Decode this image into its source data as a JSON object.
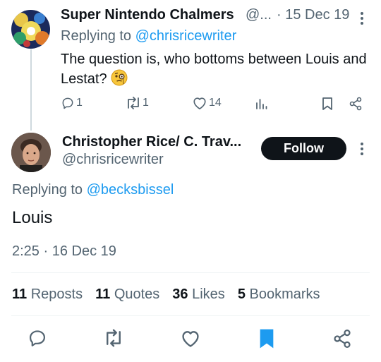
{
  "reply_tweet": {
    "author_name": "Super Nintendo Chalmers",
    "handle_truncated": "@...",
    "date": "· 15 Dec 19",
    "replying_to_label": "Replying to",
    "replying_to_handle": "@chrisricewriter",
    "text": "The question is, who bottoms between Louis and Lestat?",
    "emoji": "face-with-monocle",
    "actions": {
      "replies": "1",
      "reposts": "1",
      "likes": "14"
    }
  },
  "main_tweet": {
    "author_name": "Christopher Rice/ C. Trav...",
    "handle": "@chrisricewriter",
    "follow_label": "Follow",
    "replying_to_label": "Replying to",
    "replying_to_handle": "@becksbissel",
    "text": "Louis",
    "timestamp": "2:25 · 16 Dec 19",
    "stats": {
      "reposts_count": "11",
      "reposts_label": "Reposts",
      "quotes_count": "11",
      "quotes_label": "Quotes",
      "likes_count": "36",
      "likes_label": "Likes",
      "bookmarks_count": "5",
      "bookmarks_label": "Bookmarks"
    }
  },
  "colors": {
    "link_blue": "#1d9bf0",
    "secondary_grey": "#536471",
    "text_dark": "#0f1419",
    "follow_button_bg": "#0f1419"
  }
}
